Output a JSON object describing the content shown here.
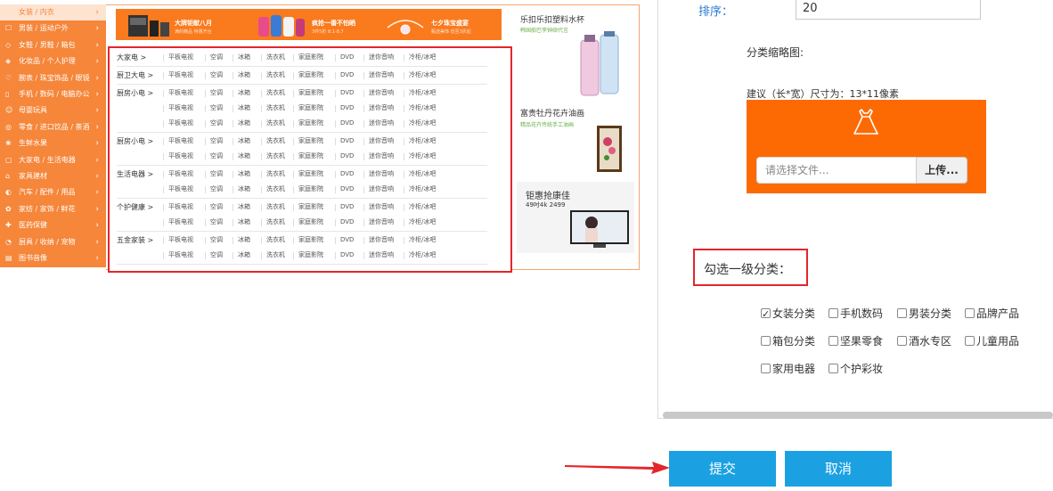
{
  "preview": {
    "sidebar_categories": [
      {
        "label": "女装 / 内衣",
        "icon": "dress-icon"
      },
      {
        "label": "男装 / 运动户外",
        "icon": "shirt-icon"
      },
      {
        "label": "女鞋 / 男鞋 / 箱包",
        "icon": "shoe-icon"
      },
      {
        "label": "化妆品 / 个人护理",
        "icon": "lipstick-icon"
      },
      {
        "label": "腕表 / 珠宝饰品 / 眼镜",
        "icon": "heart-icon"
      },
      {
        "label": "手机 / 数码 / 电脑办公",
        "icon": "phone-icon"
      },
      {
        "label": "母婴玩具",
        "icon": "toy-icon"
      },
      {
        "label": "零食 / 进口饮品 / 茶酒",
        "icon": "snack-icon"
      },
      {
        "label": "生鲜水果",
        "icon": "fruit-icon"
      },
      {
        "label": "大家电 / 生活电器",
        "icon": "appliance-icon"
      },
      {
        "label": "家具建材",
        "icon": "furniture-icon"
      },
      {
        "label": "汽车 / 配件 / 用品",
        "icon": "car-icon"
      },
      {
        "label": "家纺 / 家饰 / 鲜花",
        "icon": "flower-icon"
      },
      {
        "label": "医药保健",
        "icon": "medicine-icon"
      },
      {
        "label": "厨具 / 收纳 / 宠物",
        "icon": "kitchen-icon"
      },
      {
        "label": "图书音像",
        "icon": "book-icon"
      }
    ],
    "banner_promos": [
      {
        "title": "大牌钜献八月",
        "sub": "满的精品  特惠开合"
      },
      {
        "title": "疯抢一番不怕晒",
        "sub": "3件5折  8.1-8.7"
      },
      {
        "title": "七夕珠宝盛宴",
        "sub": "甄选美饰  低至3折起"
      }
    ],
    "sub_groups": [
      {
        "label": "大家电 >",
        "rows": 1
      },
      {
        "label": "厨卫大电 >",
        "rows": 1
      },
      {
        "label": "厨房小电 >",
        "rows": 3
      },
      {
        "label": "厨房小电 >",
        "rows": 2
      },
      {
        "label": "生活电器 >",
        "rows": 2
      },
      {
        "label": "个护健康 >",
        "rows": 2
      },
      {
        "label": "五金家装 >",
        "rows": 2
      }
    ],
    "sub_items": [
      "平板电视",
      "空调",
      "冰箱",
      "洗衣机",
      "家庭影院",
      "DVD",
      "迷你音响",
      "冷柜/冰吧"
    ],
    "right_ads": [
      {
        "title": "乐扣乐扣塑料水杯",
        "sub": "韩国舶巴李钟硕代言"
      },
      {
        "title": "富贵牡丹花卉油画",
        "sub": "精品花卉传统手工油画"
      },
      {
        "title": "钜惠抢康佳",
        "sub": "49吋4k  2499"
      }
    ]
  },
  "form": {
    "sort_label": "排序：",
    "sort_value": "20",
    "thumb_label": "分类缩略图:",
    "size_hint": "建议（长*宽）尺寸为：13*11像素",
    "file_placeholder": "请选择文件...",
    "upload_label": "上传...",
    "cat1_label": "勾选一级分类：",
    "checkboxes": [
      {
        "label": "女装分类",
        "checked": true
      },
      {
        "label": "手机数码",
        "checked": false
      },
      {
        "label": "男装分类",
        "checked": false
      },
      {
        "label": "品牌产品",
        "checked": false
      },
      {
        "label": "箱包分类",
        "checked": false
      },
      {
        "label": "坚果零食",
        "checked": false
      },
      {
        "label": "酒水专区",
        "checked": false
      },
      {
        "label": "儿童用品",
        "checked": false
      },
      {
        "label": "家用电器",
        "checked": false
      },
      {
        "label": "个护彩妆",
        "checked": false
      }
    ],
    "submit_label": "提交",
    "cancel_label": "取消"
  },
  "colors": {
    "sidebar_orange": "#f5863a",
    "upload_orange": "#fd6a03",
    "button_blue": "#1ba1e2",
    "highlight_red": "#e3262b"
  }
}
